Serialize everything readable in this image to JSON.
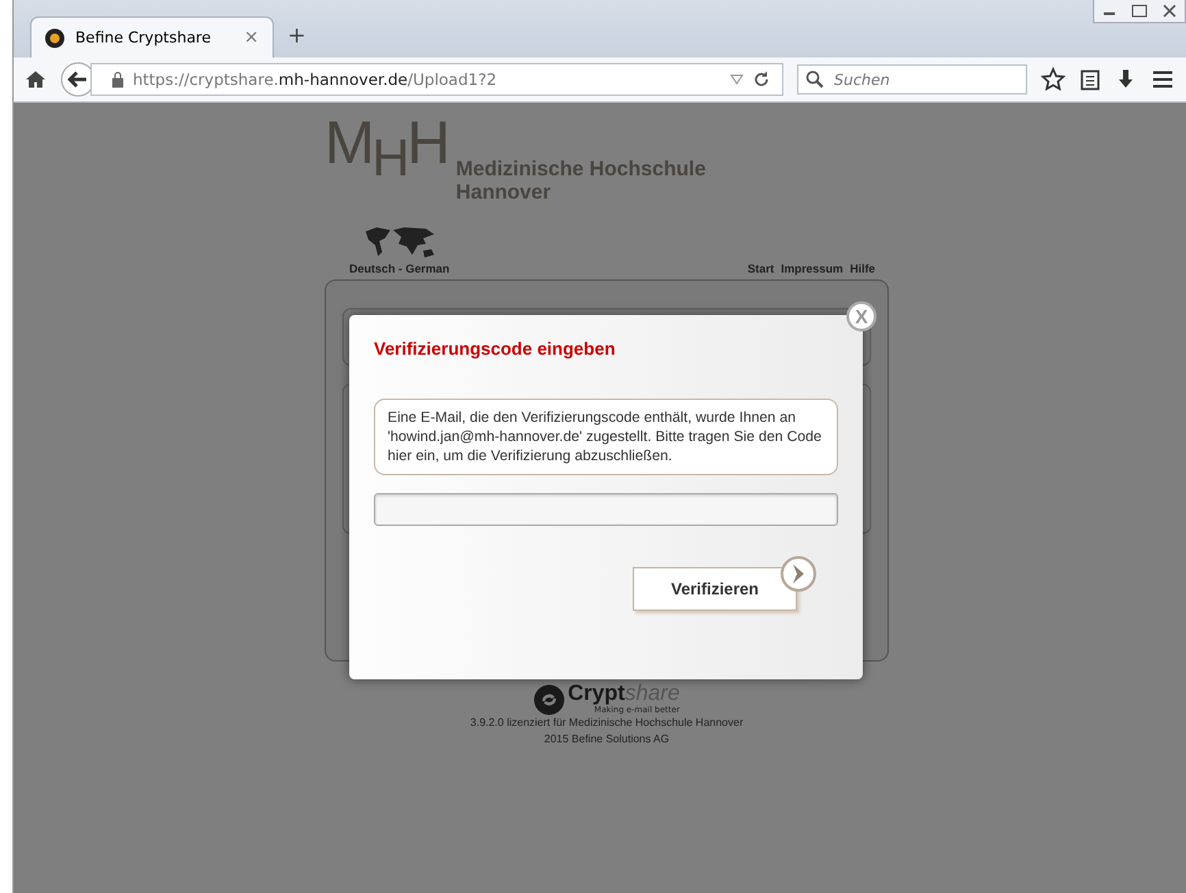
{
  "browser": {
    "tabs": [
      {
        "title": "Befine Cryptshare",
        "selected": true
      }
    ],
    "new_tab": "+",
    "tab_close": "×",
    "address": "https://cryptshare.**mh-hannover.de**/Upload1?2",
    "search": {
      "placeholder": "Suchen"
    }
  },
  "header": {
    "logo_letters": [
      "M",
      "H",
      "H"
    ],
    "institution": [
      "Medizinische Hochschule",
      "Hannover"
    ]
  },
  "language": "Deutsch - German",
  "nav_links": [
    "Start",
    "Impressum",
    "Hilfe"
  ],
  "dialog": {
    "title": "Verifizierungscode eingeben",
    "message": "Eine E-Mail, die den Verifizierungscode enthält, wurde Ihnen an 'howind.jan@mh-hannover.de' zugestellt. Bitte tragen Sie den Code hier ein, um die Verifizierung abzuschließen.",
    "close": "X",
    "button": "Verifizieren"
  },
  "footer": {
    "brand": [
      "Crypt",
      "share"
    ],
    "tagline": "Making e-mail better",
    "lines": [
      "3.9.2.0 lizenziert für Medizinische Hochschule Hannover",
      "2015 Befine Solutions AG"
    ]
  }
}
